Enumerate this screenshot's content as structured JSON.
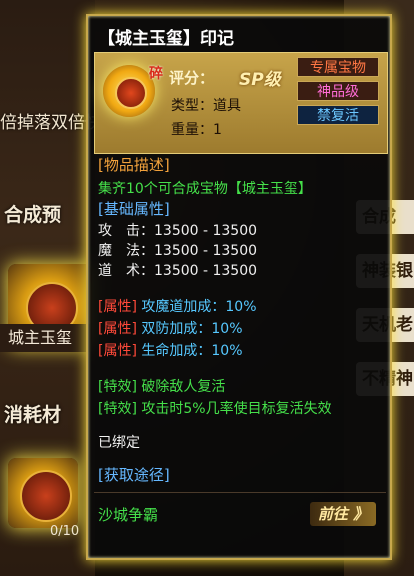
{
  "background": {
    "scroll_text": "倍掉落双倍快乐！",
    "label_hecheng": "合成预",
    "item_name": "城主玉玺",
    "label_xiaohao": "消耗材",
    "count": "0/10",
    "right_items": [
      "合成",
      "神装银",
      "天机老",
      "不精神"
    ]
  },
  "tooltip": {
    "title": "【城主玉玺】印记",
    "badge_char": "碎",
    "score_label": "评分：",
    "score_value": "SP级",
    "type_line": "类型：道具",
    "weight_line": "重量：1",
    "tags": [
      "专属宝物",
      "神品级",
      "禁复活"
    ],
    "desc_header": "[物品描述]",
    "desc_text": "集齐10个可合成宝物【城主玉玺】",
    "base_header": "[基础属性]",
    "base_attrs": [
      "攻　击：13500 - 13500",
      "魔　法：13500 - 13500",
      "道　术：13500 - 13500"
    ],
    "attr_tag": "[属性]",
    "attr_lines": [
      "攻魔道加成：10%",
      "双防加成：10%",
      "生命加成：10%"
    ],
    "effect_tag": "[特效]",
    "effect_lines": [
      "破除敌人复活",
      "攻击时5%几率使目标复活失效"
    ],
    "bound_text": "已绑定",
    "source_header": "[获取途径]",
    "source_name": "沙城争霸",
    "goto_label": "前往 》"
  },
  "colors": {
    "border_gold": "#c7a84c",
    "green": "#45e04a",
    "cyan": "#56c8ff",
    "red": "#ff4a3a",
    "orange": "#f2a23c"
  }
}
